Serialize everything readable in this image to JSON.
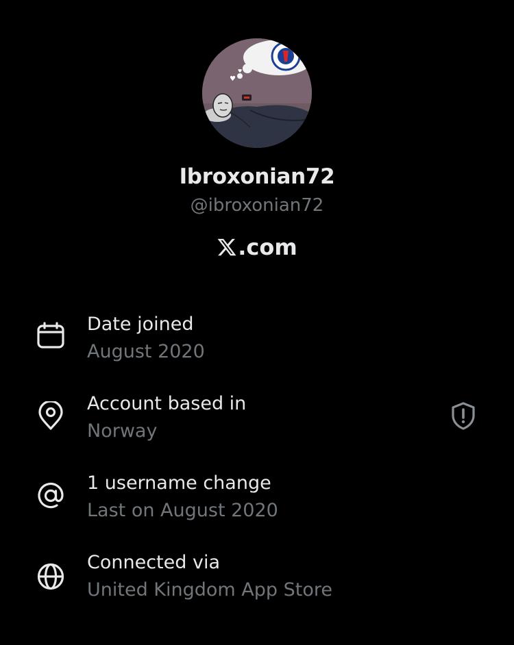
{
  "profile": {
    "display_name": "Ibroxonian72",
    "handle": "@ibroxonian72",
    "platform": ".com",
    "platform_logo": "x-logo-icon"
  },
  "details": [
    {
      "icon": "calendar-icon",
      "label": "Date joined",
      "value": "August 2020"
    },
    {
      "icon": "location-pin-icon",
      "label": "Account based in",
      "value": "Norway",
      "trailing_icon": "shield-alert-icon"
    },
    {
      "icon": "at-sign-icon",
      "label": "1 username change",
      "value": "Last on August 2020"
    },
    {
      "icon": "globe-icon",
      "label": "Connected via",
      "value": "United Kingdom App Store"
    }
  ],
  "colors": {
    "background": "#000000",
    "primary_text": "#e7e9ea",
    "secondary_text": "#71767b"
  }
}
